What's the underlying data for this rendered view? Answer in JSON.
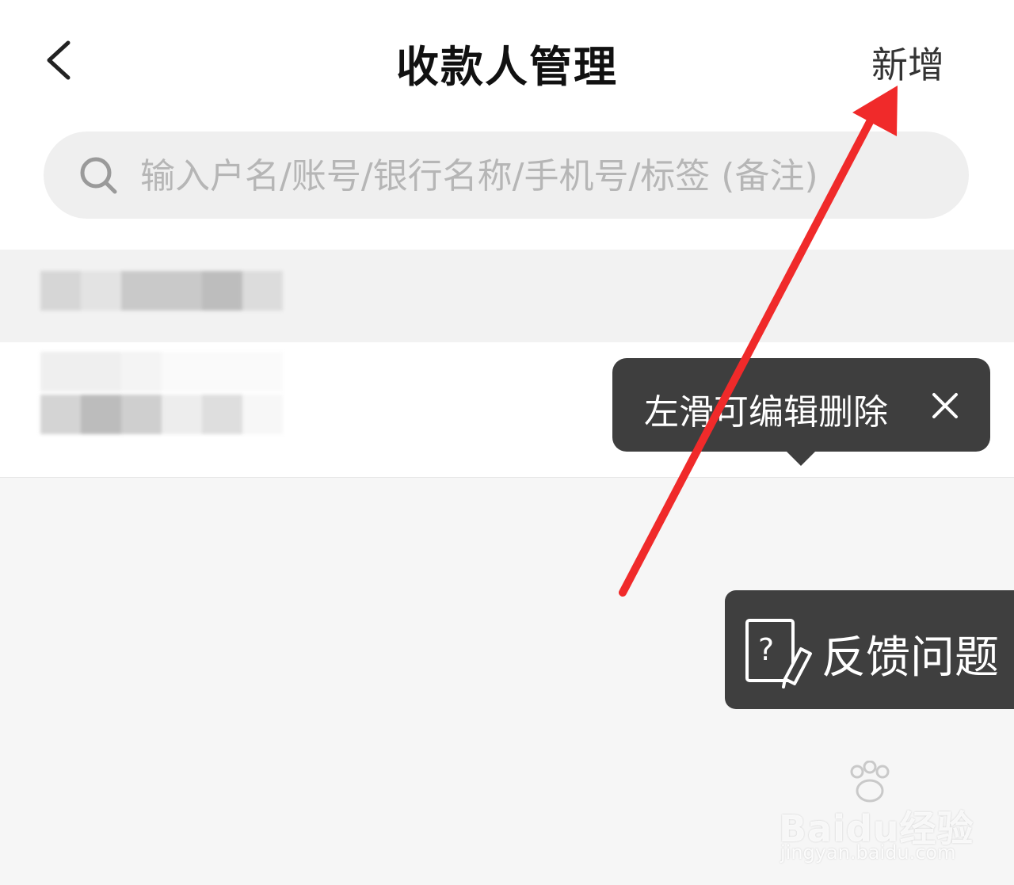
{
  "header": {
    "title": "收款人管理",
    "add_label": "新增"
  },
  "search": {
    "placeholder": "输入户名/账号/银行名称/手机号/标签 (备注)"
  },
  "tooltip": {
    "text": "左滑可编辑删除"
  },
  "feedback": {
    "label": "反馈问题"
  },
  "watermark": {
    "logo": "Baidu经验",
    "url": "jingyan.baidu.com"
  },
  "icons": {
    "back": "chevron-left-icon",
    "search": "search-icon",
    "close": "close-icon",
    "feedback": "question-edit-icon"
  },
  "colors": {
    "arrow": "#f02a2a",
    "tooltip_bg": "#3e3e3e",
    "feedback_bg": "#3f3f3f"
  }
}
